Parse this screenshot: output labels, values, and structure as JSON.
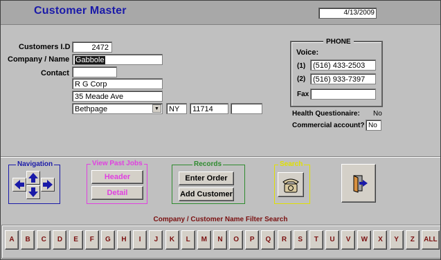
{
  "header": {
    "title": "Customer Master",
    "date": "4/13/2009"
  },
  "form": {
    "customer_id_label": "Customers I.D",
    "customer_id": "2472",
    "company_label": "Company / Name",
    "company_name": "Gabbole",
    "contact_label": "Contact",
    "contact": "",
    "address1": "R G Corp",
    "address2": "35 Meade Ave",
    "city": "Bethpage",
    "state": "NY",
    "zip": "11714",
    "extra": ""
  },
  "phone": {
    "title": "PHONE",
    "voice_label": "Voice:",
    "line1_label": "(1)",
    "line1": "(516) 433-2503",
    "line2_label": "(2)",
    "line2": "(516) 933-7397",
    "fax_label": "Fax",
    "fax": ""
  },
  "flags": {
    "health_label": "Health Questionaire:",
    "health_value": "No",
    "commercial_label": "Commercial account?",
    "commercial_value": "No"
  },
  "navigation": {
    "title": "Navigation"
  },
  "past_jobs": {
    "title": "View Past Jobs",
    "header_btn": "Header",
    "detail_btn": "Detail",
    "color": "#e040e0"
  },
  "records": {
    "title": "Records",
    "enter_order": "Enter Order",
    "add_customer": "Add Customer",
    "color": "#2e8b2e"
  },
  "search": {
    "title": "Search",
    "color": "#e0e000"
  },
  "filter": {
    "title": "Company / Customer Name Filter Search",
    "letters": [
      "A",
      "B",
      "C",
      "D",
      "E",
      "F",
      "G",
      "H",
      "I",
      "J",
      "K",
      "L",
      "M",
      "N",
      "O",
      "P",
      "Q",
      "R",
      "S",
      "T",
      "U",
      "V",
      "W",
      "X",
      "Y",
      "Z",
      "ALL"
    ]
  },
  "colors": {
    "title": "#1a1aa8",
    "nav_border": "#1a1aa8",
    "letters": "#7a1010"
  }
}
